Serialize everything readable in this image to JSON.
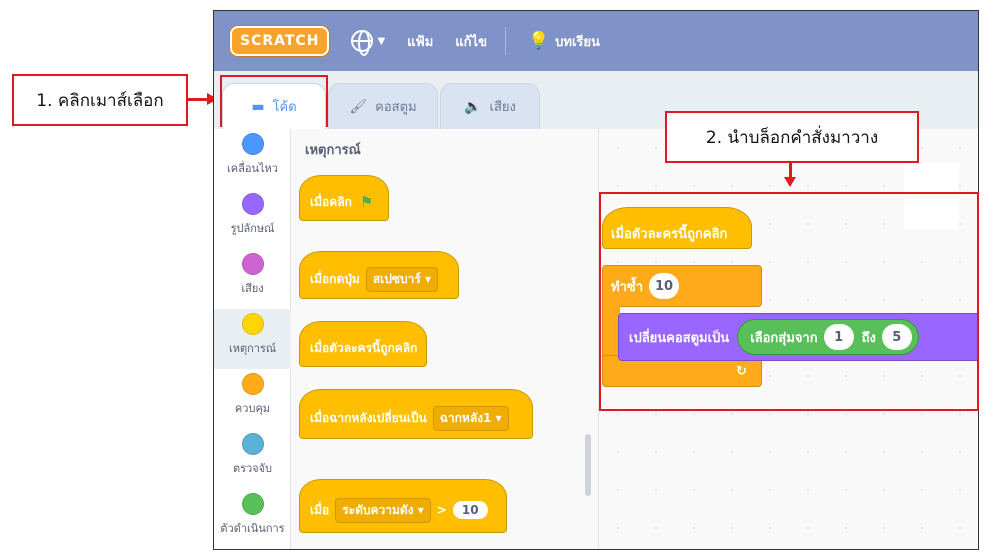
{
  "annotations": {
    "step1": "1. คลิกเมาส์เลือก",
    "step2": "2. นำบล็อกคำสั่งมาวาง"
  },
  "menubar": {
    "logo": "SCRATCH",
    "language_icon": "globe-icon",
    "file": "แฟ้ม",
    "edit": "แก้ไข",
    "tutorials": "บทเรียน"
  },
  "tabs": [
    {
      "label": "โค้ด",
      "icon": "code-icon",
      "active": true
    },
    {
      "label": "คอสตูม",
      "icon": "brush-icon",
      "active": false
    },
    {
      "label": "เสียง",
      "icon": "speaker-icon",
      "active": false
    }
  ],
  "categories": [
    {
      "label": "เคลื่อนไหว",
      "color": "#4c97ff"
    },
    {
      "label": "รูปลักษณ์",
      "color": "#9966ff"
    },
    {
      "label": "เสียง",
      "color": "#cf63cf"
    },
    {
      "label": "เหตุการณ์",
      "color": "#ffd500",
      "selected": true
    },
    {
      "label": "ควบคุม",
      "color": "#ffab19"
    },
    {
      "label": "ตรวจจับ",
      "color": "#5cb1d6"
    },
    {
      "label": "ตัวดำเนินการ",
      "color": "#59c059"
    }
  ],
  "palette": {
    "title": "เหตุการณ์",
    "blocks": {
      "when_flag": "เมื่อคลิก",
      "when_key": "เมื่อกดปุ่ม",
      "key_value": "สเปซบาร์",
      "when_sprite_clicked": "เมื่อตัวละครนี้ถูกคลิก",
      "when_backdrop": "เมื่อฉากหลังเปลี่ยนเป็น",
      "backdrop_value": "ฉากหลัง1",
      "when_prefix": "เมื่อ",
      "loudness": "ระดับความดัง",
      "gt": ">",
      "gt_value": "10"
    }
  },
  "script": {
    "hat": "เมื่อตัวละครนี้ถูกคลิก",
    "repeat": "ทำซ้ำ",
    "repeat_count": "10",
    "switch_costume": "เปลี่ยนคอสตูมเป็น",
    "pick_random": "เลือกสุ่มจาก",
    "from": "1",
    "to_label": "ถึง",
    "to": "5",
    "loop_arrow": "↻"
  }
}
